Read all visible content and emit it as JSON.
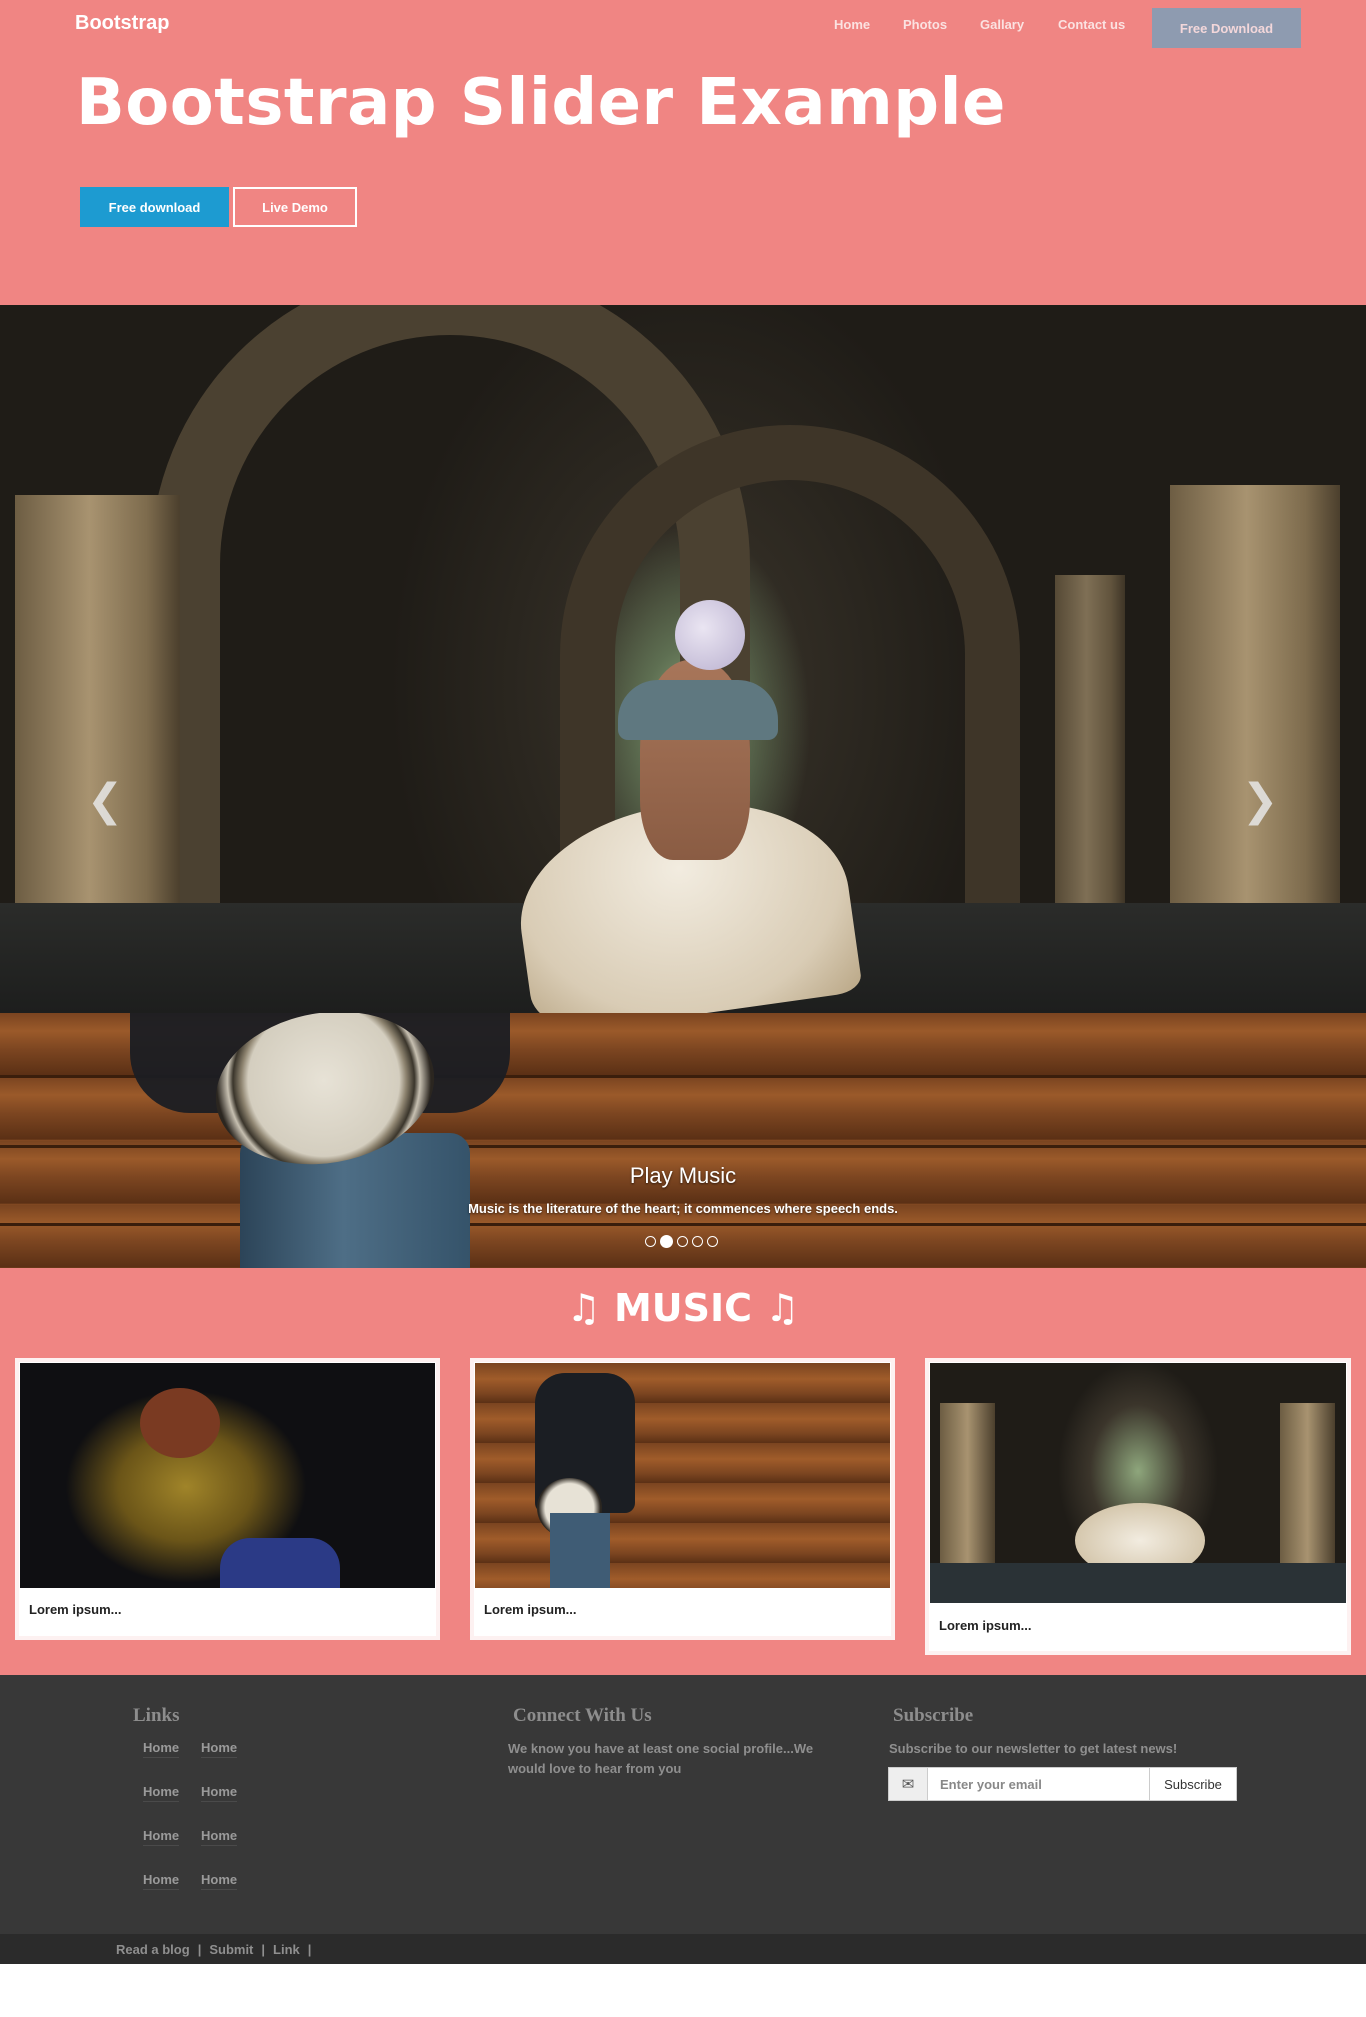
{
  "header": {
    "brand": "Bootstrap",
    "nav": [
      "Home",
      "Photos",
      "Gallary",
      "Contact us"
    ],
    "download_button": "Free Download"
  },
  "hero": {
    "title": "Bootstrap Slider Example",
    "primary_button": "Free download",
    "secondary_button": "Live Demo"
  },
  "carousel": {
    "prev_icon": "chevron-left-icon",
    "next_icon": "chevron-right-icon",
    "caption_title": "Play Music",
    "caption_text": "Music is the literature of the heart; it commences where speech ends.",
    "indicator_count": 5,
    "active_indicator": 2
  },
  "music": {
    "title": "♫ MUSIC ♫",
    "cards": [
      {
        "caption": "Lorem ipsum..."
      },
      {
        "caption": "Lorem ipsum..."
      },
      {
        "caption": "Lorem ipsum..."
      }
    ]
  },
  "footer": {
    "links": {
      "heading": "Links",
      "items": [
        "Home",
        "Home",
        "Home",
        "Home",
        "Home",
        "Home",
        "Home",
        "Home"
      ]
    },
    "connect": {
      "heading": "Connect With Us",
      "text": "We know you have at least one social profile...We would love to hear from you"
    },
    "subscribe": {
      "heading": "Subscribe",
      "text": "Subscribe to our newsletter to get latest news!",
      "icon": "envelope-icon",
      "placeholder": "Enter your email",
      "button": "Subscribe"
    },
    "bottom_links": [
      "Read a blog",
      "Submit",
      "Link"
    ]
  },
  "colors": {
    "accent": "#f08583",
    "primary_button": "#1d9bd1",
    "nav_download": "#8e9bb0",
    "footer": "#383838",
    "bottom_bar": "#2b2b2b"
  }
}
